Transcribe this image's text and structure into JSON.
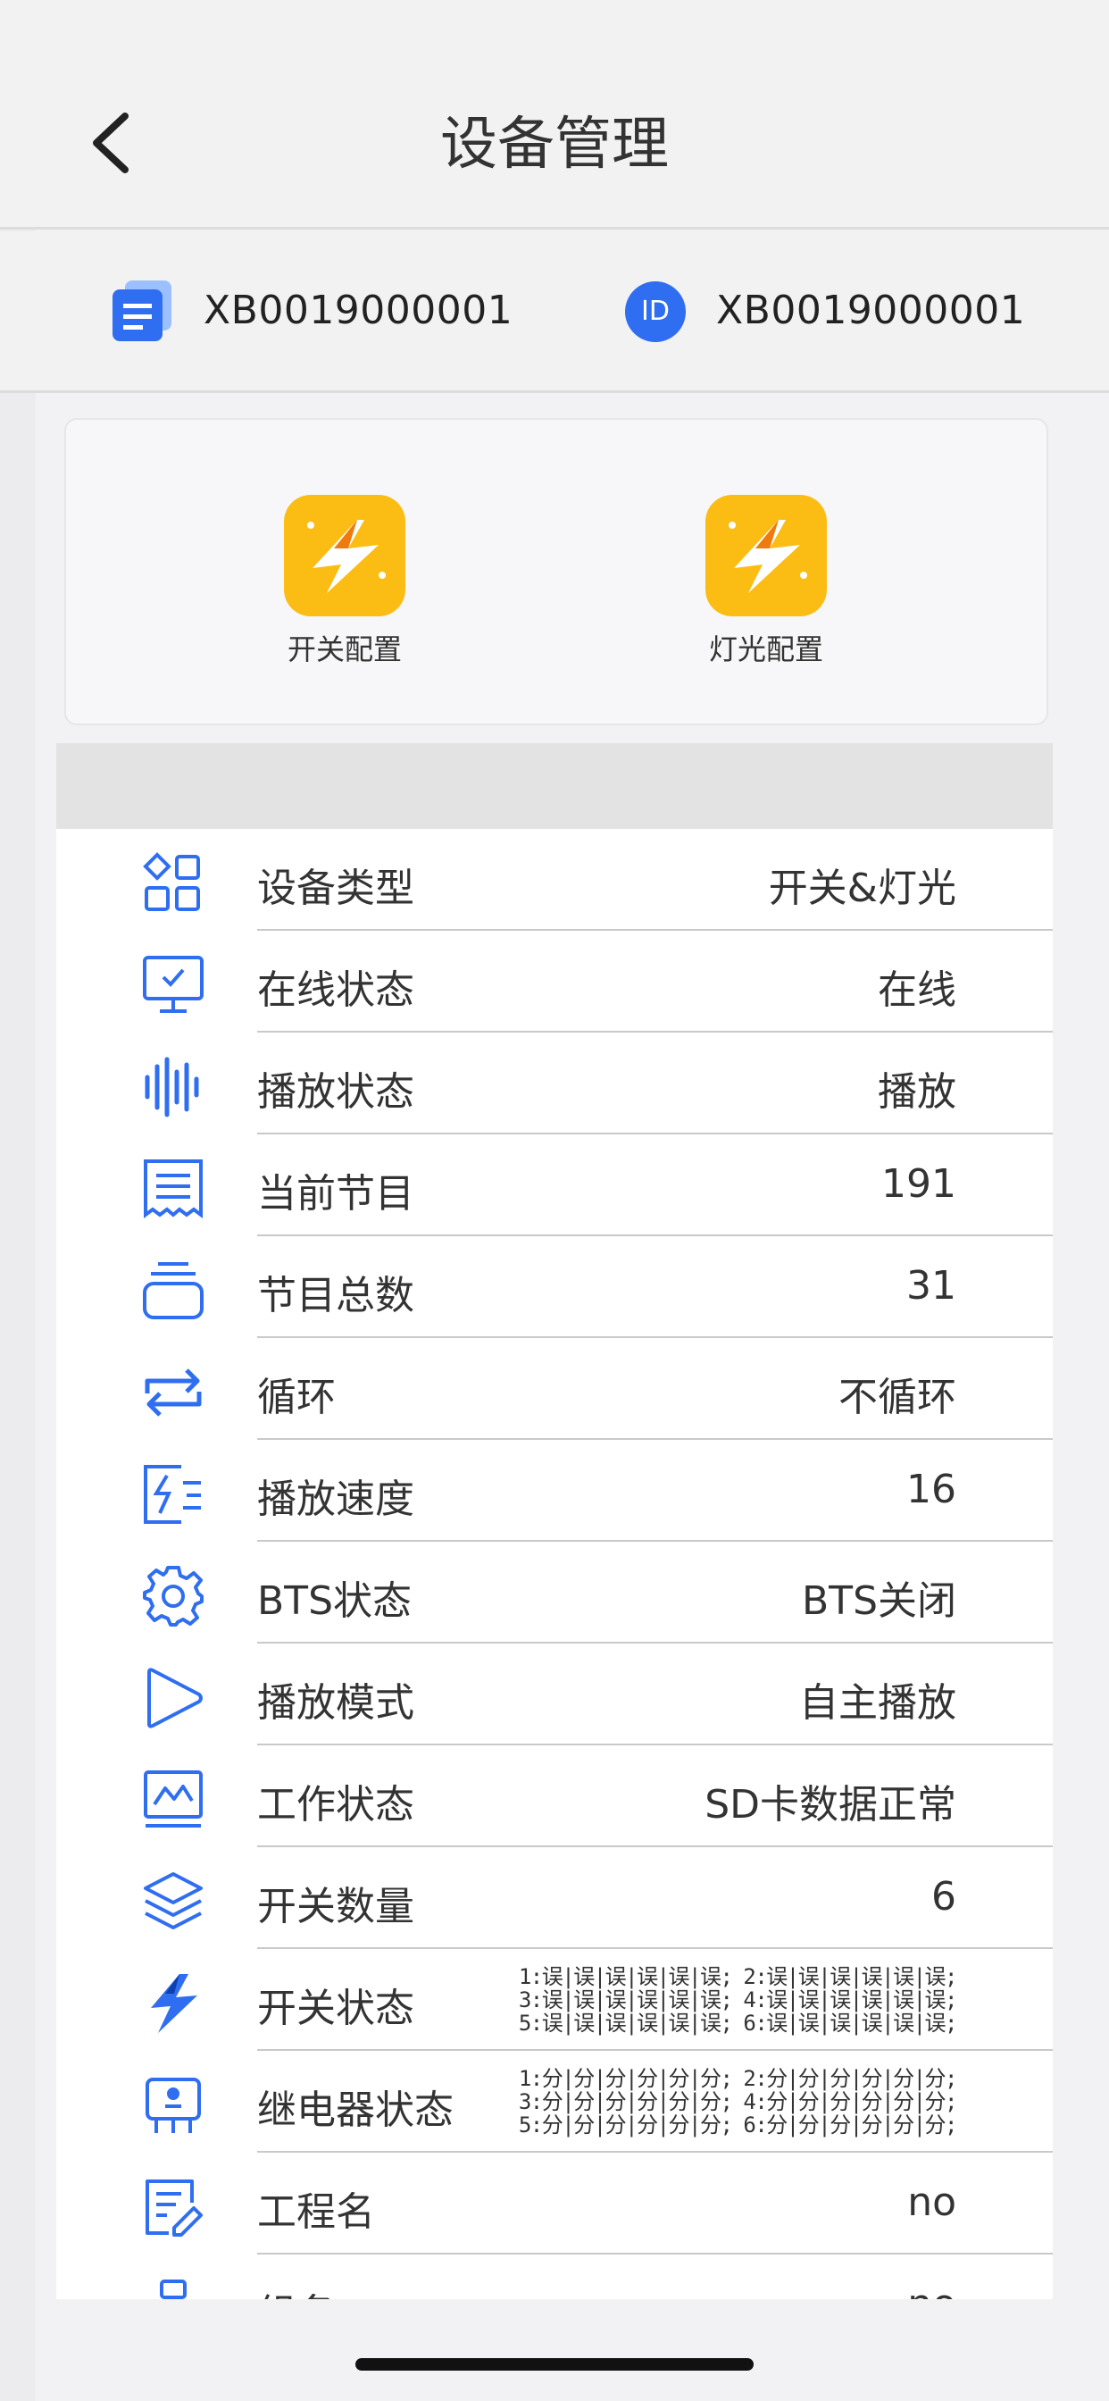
{
  "header": {
    "title": "设备管理"
  },
  "device": {
    "serial": "XB0019000001",
    "id_badge": "ID",
    "id": "XB0019000001"
  },
  "functions": [
    {
      "label": "开关配置",
      "icon": "lightning-app-icon"
    },
    {
      "label": "灯光配置",
      "icon": "lightning-app-icon"
    }
  ],
  "rows": [
    {
      "label": "设备类型",
      "value": "开关&灯光",
      "icon": "category-icon"
    },
    {
      "label": "在线状态",
      "value": "在线",
      "icon": "monitor-check-icon"
    },
    {
      "label": "播放状态",
      "value": "播放",
      "icon": "waveform-icon"
    },
    {
      "label": "当前节目",
      "value": "191",
      "icon": "receipt-icon"
    },
    {
      "label": "节目总数",
      "value": "31",
      "icon": "stack-icon"
    },
    {
      "label": "循环",
      "value": "不循环",
      "icon": "repeat-icon"
    },
    {
      "label": "播放速度",
      "value": "16",
      "icon": "speed-icon"
    },
    {
      "label": "BTS状态",
      "value": "BTS关闭",
      "icon": "gear-icon"
    },
    {
      "label": "播放模式",
      "value": "自主播放",
      "icon": "play-icon"
    },
    {
      "label": "工作状态",
      "value": "SD卡数据正常",
      "icon": "chart-icon"
    },
    {
      "label": "开关数量",
      "value": "6",
      "icon": "layers-icon"
    },
    {
      "label": "开关状态",
      "value_lines": [
        "1:误|误|误|误|误|误; 2:误|误|误|误|误|误;",
        "3:误|误|误|误|误|误; 4:误|误|误|误|误|误;",
        "5:误|误|误|误|误|误; 6:误|误|误|误|误|误;"
      ],
      "icon": "bolt-icon"
    },
    {
      "label": "继电器状态",
      "value_lines": [
        "1:分|分|分|分|分|分; 2:分|分|分|分|分|分;",
        "3:分|分|分|分|分|分; 4:分|分|分|分|分|分;",
        "5:分|分|分|分|分|分; 6:分|分|分|分|分|分;"
      ],
      "icon": "relay-icon"
    },
    {
      "label": "工程名",
      "value": "no",
      "icon": "edit-doc-icon"
    },
    {
      "label": "组名",
      "value": "no",
      "icon": "network-icon"
    }
  ],
  "colors": {
    "accent": "#2f6ef0",
    "app_icon": "#fbbd13"
  }
}
